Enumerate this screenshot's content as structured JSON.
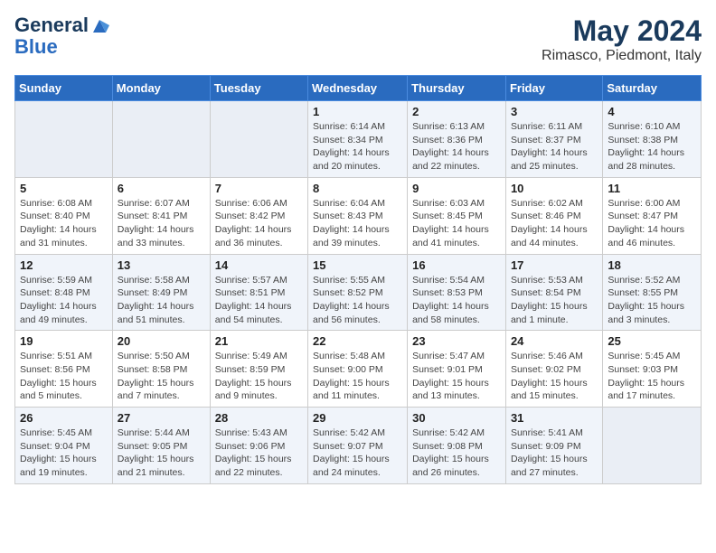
{
  "logo": {
    "line1": "General",
    "line2": "Blue"
  },
  "title": "May 2024",
  "subtitle": "Rimasco, Piedmont, Italy",
  "days_of_week": [
    "Sunday",
    "Monday",
    "Tuesday",
    "Wednesday",
    "Thursday",
    "Friday",
    "Saturday"
  ],
  "weeks": [
    [
      {
        "day": "",
        "info": ""
      },
      {
        "day": "",
        "info": ""
      },
      {
        "day": "",
        "info": ""
      },
      {
        "day": "1",
        "info": "Sunrise: 6:14 AM\nSunset: 8:34 PM\nDaylight: 14 hours\nand 20 minutes."
      },
      {
        "day": "2",
        "info": "Sunrise: 6:13 AM\nSunset: 8:36 PM\nDaylight: 14 hours\nand 22 minutes."
      },
      {
        "day": "3",
        "info": "Sunrise: 6:11 AM\nSunset: 8:37 PM\nDaylight: 14 hours\nand 25 minutes."
      },
      {
        "day": "4",
        "info": "Sunrise: 6:10 AM\nSunset: 8:38 PM\nDaylight: 14 hours\nand 28 minutes."
      }
    ],
    [
      {
        "day": "5",
        "info": "Sunrise: 6:08 AM\nSunset: 8:40 PM\nDaylight: 14 hours\nand 31 minutes."
      },
      {
        "day": "6",
        "info": "Sunrise: 6:07 AM\nSunset: 8:41 PM\nDaylight: 14 hours\nand 33 minutes."
      },
      {
        "day": "7",
        "info": "Sunrise: 6:06 AM\nSunset: 8:42 PM\nDaylight: 14 hours\nand 36 minutes."
      },
      {
        "day": "8",
        "info": "Sunrise: 6:04 AM\nSunset: 8:43 PM\nDaylight: 14 hours\nand 39 minutes."
      },
      {
        "day": "9",
        "info": "Sunrise: 6:03 AM\nSunset: 8:45 PM\nDaylight: 14 hours\nand 41 minutes."
      },
      {
        "day": "10",
        "info": "Sunrise: 6:02 AM\nSunset: 8:46 PM\nDaylight: 14 hours\nand 44 minutes."
      },
      {
        "day": "11",
        "info": "Sunrise: 6:00 AM\nSunset: 8:47 PM\nDaylight: 14 hours\nand 46 minutes."
      }
    ],
    [
      {
        "day": "12",
        "info": "Sunrise: 5:59 AM\nSunset: 8:48 PM\nDaylight: 14 hours\nand 49 minutes."
      },
      {
        "day": "13",
        "info": "Sunrise: 5:58 AM\nSunset: 8:49 PM\nDaylight: 14 hours\nand 51 minutes."
      },
      {
        "day": "14",
        "info": "Sunrise: 5:57 AM\nSunset: 8:51 PM\nDaylight: 14 hours\nand 54 minutes."
      },
      {
        "day": "15",
        "info": "Sunrise: 5:55 AM\nSunset: 8:52 PM\nDaylight: 14 hours\nand 56 minutes."
      },
      {
        "day": "16",
        "info": "Sunrise: 5:54 AM\nSunset: 8:53 PM\nDaylight: 14 hours\nand 58 minutes."
      },
      {
        "day": "17",
        "info": "Sunrise: 5:53 AM\nSunset: 8:54 PM\nDaylight: 15 hours\nand 1 minute."
      },
      {
        "day": "18",
        "info": "Sunrise: 5:52 AM\nSunset: 8:55 PM\nDaylight: 15 hours\nand 3 minutes."
      }
    ],
    [
      {
        "day": "19",
        "info": "Sunrise: 5:51 AM\nSunset: 8:56 PM\nDaylight: 15 hours\nand 5 minutes."
      },
      {
        "day": "20",
        "info": "Sunrise: 5:50 AM\nSunset: 8:58 PM\nDaylight: 15 hours\nand 7 minutes."
      },
      {
        "day": "21",
        "info": "Sunrise: 5:49 AM\nSunset: 8:59 PM\nDaylight: 15 hours\nand 9 minutes."
      },
      {
        "day": "22",
        "info": "Sunrise: 5:48 AM\nSunset: 9:00 PM\nDaylight: 15 hours\nand 11 minutes."
      },
      {
        "day": "23",
        "info": "Sunrise: 5:47 AM\nSunset: 9:01 PM\nDaylight: 15 hours\nand 13 minutes."
      },
      {
        "day": "24",
        "info": "Sunrise: 5:46 AM\nSunset: 9:02 PM\nDaylight: 15 hours\nand 15 minutes."
      },
      {
        "day": "25",
        "info": "Sunrise: 5:45 AM\nSunset: 9:03 PM\nDaylight: 15 hours\nand 17 minutes."
      }
    ],
    [
      {
        "day": "26",
        "info": "Sunrise: 5:45 AM\nSunset: 9:04 PM\nDaylight: 15 hours\nand 19 minutes."
      },
      {
        "day": "27",
        "info": "Sunrise: 5:44 AM\nSunset: 9:05 PM\nDaylight: 15 hours\nand 21 minutes."
      },
      {
        "day": "28",
        "info": "Sunrise: 5:43 AM\nSunset: 9:06 PM\nDaylight: 15 hours\nand 22 minutes."
      },
      {
        "day": "29",
        "info": "Sunrise: 5:42 AM\nSunset: 9:07 PM\nDaylight: 15 hours\nand 24 minutes."
      },
      {
        "day": "30",
        "info": "Sunrise: 5:42 AM\nSunset: 9:08 PM\nDaylight: 15 hours\nand 26 minutes."
      },
      {
        "day": "31",
        "info": "Sunrise: 5:41 AM\nSunset: 9:09 PM\nDaylight: 15 hours\nand 27 minutes."
      },
      {
        "day": "",
        "info": ""
      }
    ]
  ],
  "shaded_rows": [
    0,
    2,
    4
  ]
}
